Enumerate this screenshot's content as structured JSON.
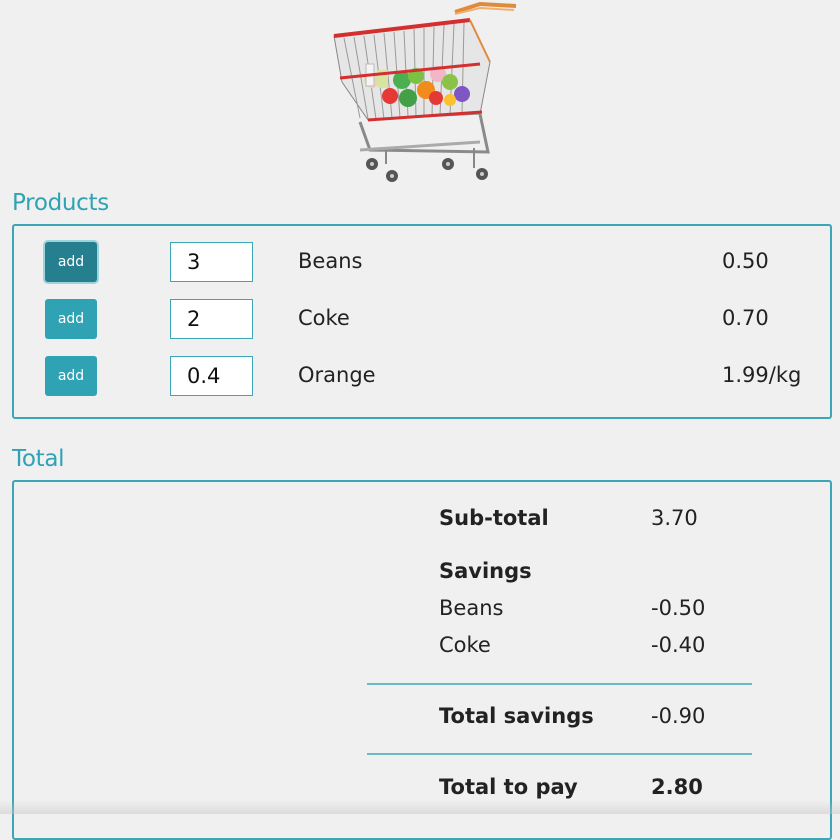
{
  "header": {
    "image": "shopping-cart-icon"
  },
  "products": {
    "title": "Products",
    "items": [
      {
        "button": "add",
        "quantity": "3",
        "name": "Beans",
        "price": "0.50"
      },
      {
        "button": "add",
        "quantity": "2",
        "name": "Coke",
        "price": "0.70"
      },
      {
        "button": "add",
        "quantity": "0.4",
        "name": "Orange",
        "price": "1.99/kg"
      }
    ]
  },
  "total": {
    "title": "Total",
    "subtotal_label": "Sub-total",
    "subtotal_value": "3.70",
    "savings_label": "Savings",
    "savings": [
      {
        "label": "Beans",
        "value": "-0.50"
      },
      {
        "label": "Coke",
        "value": "-0.40"
      }
    ],
    "total_savings_label": "Total savings",
    "total_savings_value": "-0.90",
    "to_pay_label": "Total to pay",
    "to_pay_value": "2.80"
  },
  "colors": {
    "accent": "#2fa3b4",
    "accent_dark": "#257f8e",
    "background": "#f0f0f0"
  }
}
